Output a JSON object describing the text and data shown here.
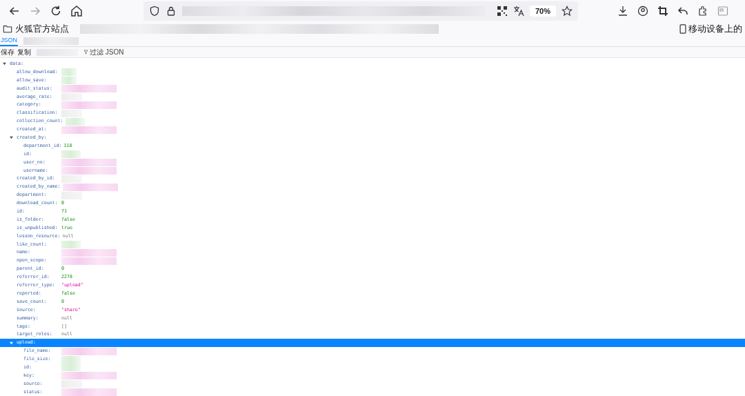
{
  "toolbar": {
    "zoom": "70%"
  },
  "bookmarks": {
    "folder": "火狐官方站点",
    "mobile": "移动设备上的"
  },
  "viewer_tabs": [
    {
      "label": "JSON",
      "selected": true
    }
  ],
  "viewer_buttons": [
    "保存",
    "复制"
  ],
  "filter": {
    "placeholder": "过滤 JSON"
  },
  "tree": [
    {
      "key": "data:",
      "expanded": true,
      "selected": false,
      "children": [
        {
          "key": "allow_download:",
          "kind": "boolean",
          "redacted": true
        },
        {
          "key": "allow_save:",
          "kind": "boolean",
          "redacted": true
        },
        {
          "key": "audit_status:",
          "kind": "string",
          "redacted": true
        },
        {
          "key": "average_rate:",
          "kind": "null",
          "redacted": true
        },
        {
          "key": "category:",
          "kind": "string",
          "redacted": true
        },
        {
          "key": "classification:",
          "kind": "null",
          "redacted": true
        },
        {
          "key": "collection_count:",
          "kind": "number",
          "redacted": true
        },
        {
          "key": "created_at:",
          "kind": "string",
          "redacted": true
        },
        {
          "key": "created_by:",
          "expanded": true,
          "selected": false,
          "children": [
            {
              "key": "department_id:",
              "kind": "number",
              "value": "118"
            },
            {
              "key": "id:",
              "kind": "number",
              "redacted": true
            },
            {
              "key": "user_no:",
              "kind": "string",
              "redacted": true
            },
            {
              "key": "username:",
              "kind": "string",
              "redacted": true
            }
          ]
        },
        {
          "key": "created_by_id:",
          "kind": "null",
          "redacted": true
        },
        {
          "key": "created_by_name:",
          "kind": "string",
          "redacted": true
        },
        {
          "key": "department:",
          "kind": "null",
          "redacted": true
        },
        {
          "key": "download_count:",
          "kind": "number",
          "value": "0"
        },
        {
          "key": "id:",
          "kind": "number",
          "value": "71"
        },
        {
          "key": "is_folder:",
          "kind": "boolean",
          "value": "false"
        },
        {
          "key": "is_unpublished:",
          "kind": "boolean",
          "value": "true"
        },
        {
          "key": "lesson_resource:",
          "kind": "null",
          "value": "null"
        },
        {
          "key": "like_count:",
          "kind": "number",
          "redacted": true
        },
        {
          "key": "name:",
          "kind": "string",
          "redacted": true
        },
        {
          "key": "open_scope:",
          "kind": "string",
          "redacted": true
        },
        {
          "key": "parent_id:",
          "kind": "number",
          "value": "0"
        },
        {
          "key": "referrer_id:",
          "kind": "number",
          "value": "2278"
        },
        {
          "key": "referrer_type:",
          "kind": "string",
          "value": "\"upload\""
        },
        {
          "key": "reported:",
          "kind": "boolean",
          "value": "false"
        },
        {
          "key": "save_count:",
          "kind": "number",
          "value": "0"
        },
        {
          "key": "source:",
          "kind": "string",
          "value": "\"share\""
        },
        {
          "key": "summary:",
          "kind": "null",
          "value": "null"
        },
        {
          "key": "tags:",
          "kind": "null",
          "value": "[]"
        },
        {
          "key": "target_roles:",
          "kind": "null",
          "value": "null"
        },
        {
          "key": "upload:",
          "expanded": true,
          "selected": true,
          "children": [
            {
              "key": "file_name:",
              "kind": "string",
              "redacted": true
            },
            {
              "key": "file_size:",
              "kind": "number",
              "redacted": true
            },
            {
              "key": "id:",
              "kind": "number",
              "redacted": true
            },
            {
              "key": "key:",
              "kind": "string",
              "redacted": true
            },
            {
              "key": "source:",
              "kind": "null",
              "redacted": true
            },
            {
              "key": "status:",
              "kind": "string",
              "redacted": true
            }
          ]
        }
      ]
    }
  ]
}
